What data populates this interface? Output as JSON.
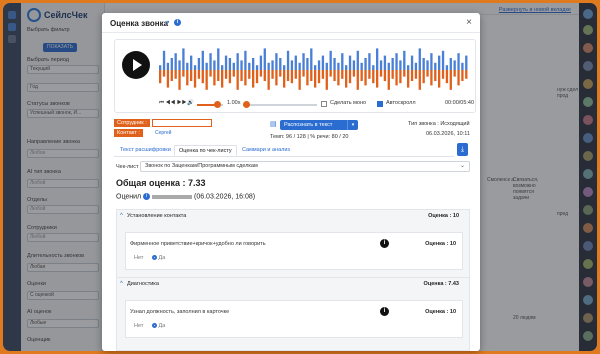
{
  "app": {
    "brand": "СейлсЧек"
  },
  "filters": {
    "choose_filter": "Выбрать фильтр",
    "show_button": "ПОКАЗАТЬ",
    "period_label": "Выбрать период",
    "period_value": "Текущий",
    "year_value": "Год",
    "call_status_label": "Статусы звонков",
    "call_status_value": "Успешный звонок, И...",
    "direction_label": "Направление звонка",
    "direction_value": "Любое",
    "ai_type_label": "AI тип звонка",
    "ai_type_value": "Любой",
    "departments_label": "Отделы",
    "departments_value": "Любой",
    "employees_label": "Сотрудники",
    "employees_value": "Любой",
    "duration_label": "Длительность звонков",
    "duration_value": "Любая",
    "score_label": "Оценки",
    "score_value": "С оценкой",
    "ai_score_label": "AI оценок",
    "ai_score_value": "Любые",
    "extra_label": "Оценщик"
  },
  "background": {
    "expand_link": "Развернуть в новой вкладке",
    "cells": [
      "Смоленск а",
      "Связаться, возможно появятся задачи",
      "20 людям",
      "нуж сдел прод",
      "пред"
    ]
  },
  "modal": {
    "title": "Оценка звонка",
    "close_label": "×",
    "player": {
      "speed": "1.00x",
      "mono_label": "Сделать моно",
      "mono_checked": false,
      "autoscroll_label": "Автоскролл",
      "autoscroll_checked": true,
      "time": "00:00/05:40",
      "progress": 0.0,
      "volume": 0.75
    },
    "employee_tag": "Сотрудник :",
    "employee_value": "",
    "contact_tag": "Контакт :",
    "contact_value": "Сергей",
    "recognize_button": "Распознать в текст",
    "tempo": "Темп: 96 / 128 | % речи: 80 / 20",
    "call_type": "Тип звонка : Исходящий",
    "date": "06.03.2026, 10:11",
    "tabs": [
      {
        "label": "Текст расшифровки",
        "active": false
      },
      {
        "label": "Оценка по чек-листу",
        "active": true
      },
      {
        "label": "Саммари и анализ",
        "active": false
      }
    ],
    "checklist_label": "Чек-лист :",
    "checklist_value": "Звонок по Заценкам/Программным сделкам",
    "total_score": "Общая оценка : 7.33",
    "evaluated_label": "Оценил",
    "evaluated_date": "(06.03.2026, 16:08)",
    "sections": [
      {
        "title": "Установление контакта",
        "score": "Оценка : 10",
        "criterion": "Фирменное приветствие+кричок+удобно ли говорить",
        "criterion_score": "Оценка : 10",
        "option_no": "Нет",
        "option_yes": "Да",
        "selected": "yes"
      },
      {
        "title": "Диагностика",
        "score": "Оценка : 7.43",
        "criterion": "Узнал должность, заполнил в карточке",
        "criterion_score": "Оценка : 10",
        "option_no": "Нет",
        "option_yes": "Да",
        "selected": "yes"
      }
    ]
  },
  "colors": {
    "accent": "#2b6cd1",
    "orange": "#e0611b",
    "wave_blue": "#4a7fd6"
  },
  "waveform": {
    "top": [
      0.2,
      0.8,
      0.3,
      0.5,
      0.7,
      0.4,
      0.9,
      0.3,
      0.6,
      0.2,
      0.5,
      0.8,
      0.3,
      0.7,
      0.4,
      0.9,
      0.2,
      0.6,
      0.5,
      0.3,
      0.7,
      0.4,
      0.8,
      0.3,
      0.5,
      0.2,
      0.6,
      0.9,
      0.3,
      0.4,
      0.7,
      0.5,
      0.2,
      0.8,
      0.4,
      0.6,
      0.3,
      0.7,
      0.5,
      0.9,
      0.2,
      0.4,
      0.6,
      0.3,
      0.8,
      0.5,
      0.3,
      0.7,
      0.2,
      0.6,
      0.4,
      0.8,
      0.3,
      0.5,
      0.7,
      0.2,
      0.9,
      0.4,
      0.6,
      0.3,
      0.5,
      0.7,
      0.4,
      0.8,
      0.2,
      0.6,
      0.3,
      0.9,
      0.5,
      0.4,
      0.7,
      0.3,
      0.6,
      0.8,
      0.2,
      0.5,
      0.4,
      0.7,
      0.3,
      0.6
    ],
    "bottom": [
      0.6,
      0.3,
      0.8,
      0.5,
      0.4,
      0.9,
      0.3,
      0.7,
      0.5,
      0.8,
      0.4,
      0.6,
      0.9,
      0.3,
      0.7,
      0.5,
      0.8,
      0.4,
      0.6,
      0.3,
      0.9,
      0.5,
      0.7,
      0.4,
      0.8,
      0.6,
      0.3,
      0.5,
      0.9,
      0.4,
      0.7,
      0.3,
      0.8,
      0.5,
      0.6,
      0.4,
      0.9,
      0.3,
      0.7,
      0.5,
      0.8,
      0.6,
      0.4,
      0.9,
      0.3,
      0.5,
      0.7,
      0.4,
      0.8,
      0.6,
      0.3,
      0.9,
      0.5,
      0.7,
      0.4,
      0.6,
      0.8,
      0.3,
      0.5,
      0.9,
      0.4,
      0.7,
      0.6,
      0.3,
      0.8,
      0.5,
      0.4,
      0.9,
      0.6,
      0.3,
      0.7,
      0.5,
      0.8,
      0.4,
      0.6,
      0.9,
      0.3,
      0.7,
      0.5,
      0.4
    ]
  }
}
